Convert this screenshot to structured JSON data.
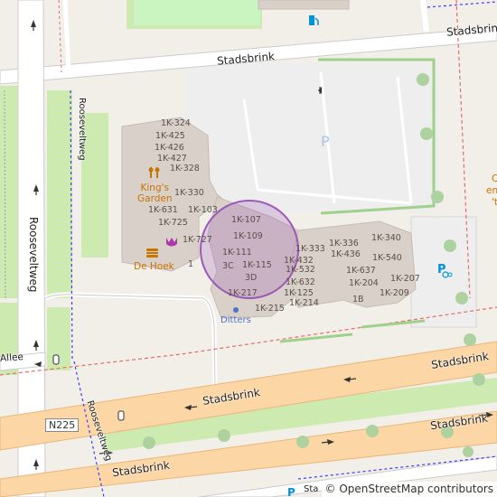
{
  "map": {
    "streets": {
      "stadsbrink_top": "Stadsbrink",
      "stadsbrink_upper_right": "Stadsbrink",
      "stadsbrink_main_left": "Stadsbrink",
      "stadsbrink_main_right": "Stadsbrink",
      "stadsbrink_lower_left": "Stadsbrink",
      "stadsbrink_lower_right": "Stadsbrink",
      "rooseveltweg_left": "Rooseveltweg",
      "rooseveltweg_mid": "Rooseveltweg",
      "rooseveltweg_bottom": "Rooseveltweg",
      "allee": "Allee",
      "bottom_cut": "Sta"
    },
    "road_ref": "N225",
    "parking_label": "P",
    "pois": {
      "kings_garden": "King's\nGarden",
      "de_hoek": "De Hoek",
      "ditters": "Ditters"
    },
    "edge_text": {
      "right_c": "C",
      "right_en": "en",
      "right_t": "'t"
    },
    "house_numbers": [
      "1K-324",
      "1K-425",
      "1K-426",
      "1K-427",
      "1K-328",
      "1K-330",
      "1K-631",
      "1K-103",
      "1K-725",
      "1K-727",
      "1",
      "1K-107",
      "1K-109",
      "1K-111",
      "3C",
      "1K-115",
      "3D",
      "1K-217",
      "1K-215",
      "1K-333",
      "1K-432",
      "1K-532",
      "1K-632",
      "1K-125",
      "1K-214",
      "1K-336",
      "1K-436",
      "1K-340",
      "1K-540",
      "1K-637",
      "1K-204",
      "1K-207",
      "1K-209",
      "1B"
    ],
    "attribution": "© OpenStreetMap contributors",
    "colors": {
      "background": "#f2efe9",
      "building": "#d9d0c9",
      "road_primary": "#fcd6a4",
      "road_minor": "#ffffff",
      "park": "#c8facc",
      "grass": "#cdebb0",
      "parking": "#eeeeee",
      "boundary": "#e66c6c",
      "highlight_circle": "#9b59b6",
      "tree": "#aed1a0",
      "poi_orange": "#c77400",
      "poi_purple": "#ac39ac",
      "poi_blue": "#0092da"
    }
  }
}
